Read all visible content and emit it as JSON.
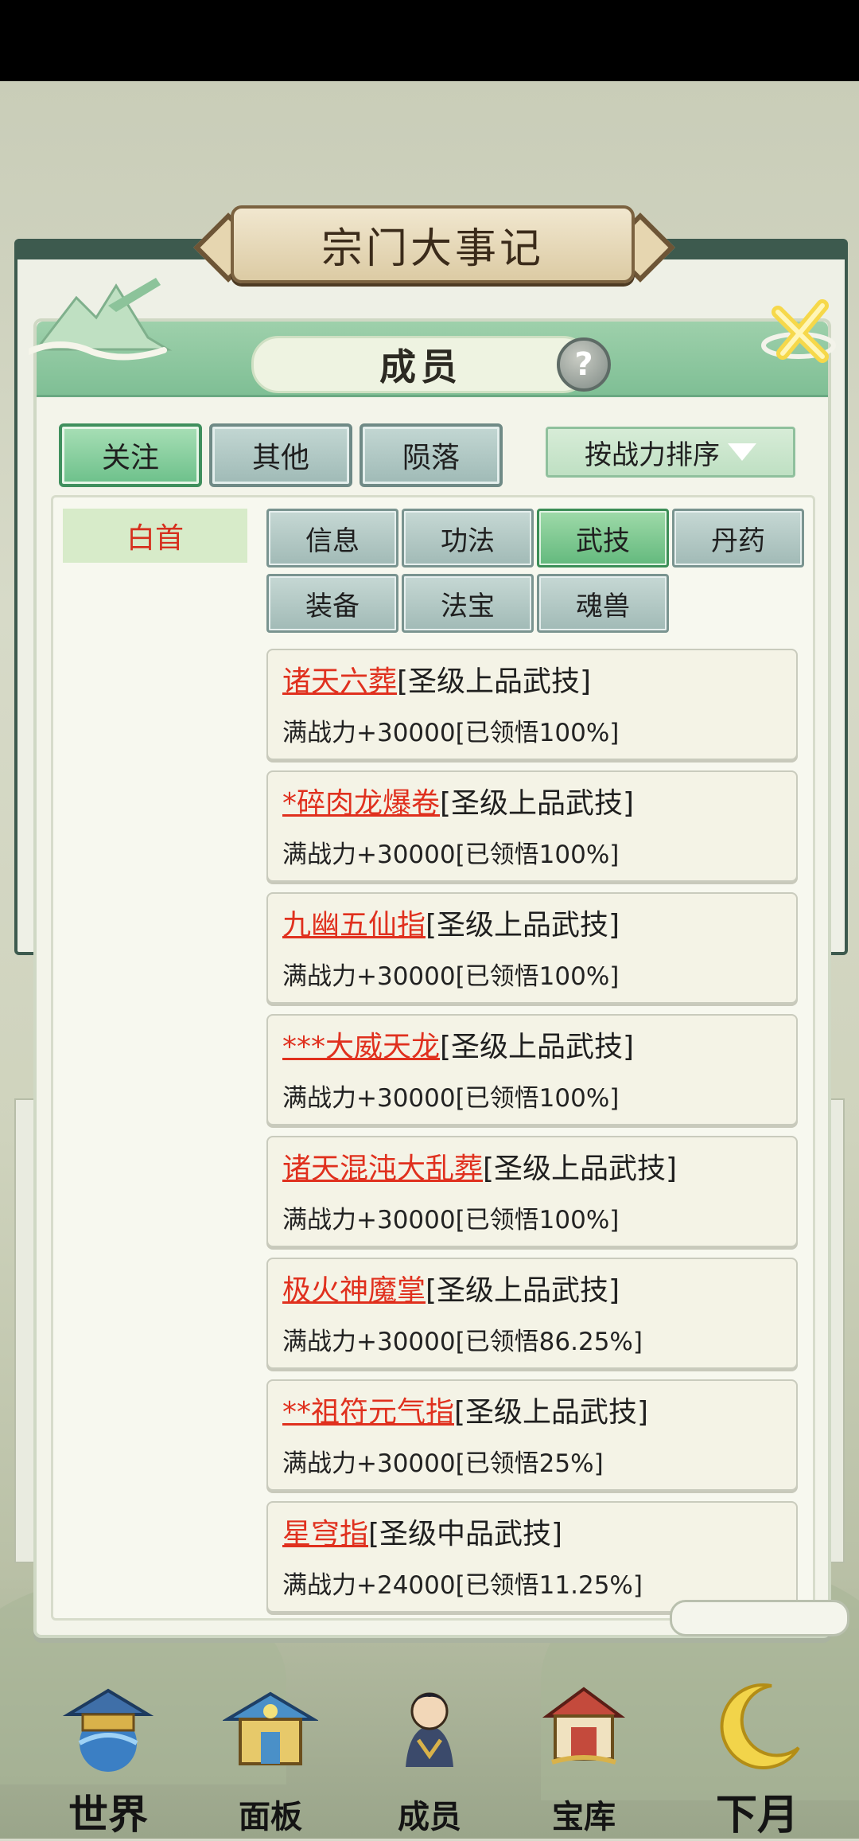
{
  "background": {
    "chronicle_title": "宗门大事记"
  },
  "dialog": {
    "title": "成员",
    "help_label": "?",
    "filters": [
      {
        "label": "关注",
        "active": true
      },
      {
        "label": "其他",
        "active": false
      },
      {
        "label": "陨落",
        "active": false
      }
    ],
    "sort": {
      "label": "按战力排序"
    },
    "member": {
      "name": "白首"
    },
    "category_tabs": [
      {
        "label": "信息",
        "active": false
      },
      {
        "label": "功法",
        "active": false
      },
      {
        "label": "武技",
        "active": true
      },
      {
        "label": "丹药",
        "active": false
      },
      {
        "label": "装备",
        "active": false
      },
      {
        "label": "法宝",
        "active": false
      },
      {
        "label": "魂兽",
        "active": false
      }
    ],
    "skills": [
      {
        "name": "诸天六葬",
        "grade": "[圣级上品武技]",
        "detail": "满战力+30000[已领悟100%]"
      },
      {
        "name": "*碎肉龙爆卷",
        "grade": "[圣级上品武技]",
        "detail": "满战力+30000[已领悟100%]"
      },
      {
        "name": "九幽五仙指",
        "grade": "[圣级上品武技]",
        "detail": "满战力+30000[已领悟100%]"
      },
      {
        "name": "***大威天龙",
        "grade": "[圣级上品武技]",
        "detail": "满战力+30000[已领悟100%]"
      },
      {
        "name": "诸天混沌大乱葬",
        "grade": "[圣级上品武技]",
        "detail": "满战力+30000[已领悟100%]"
      },
      {
        "name": "极火神魔掌",
        "grade": "[圣级上品武技]",
        "detail": "满战力+30000[已领悟86.25%]"
      },
      {
        "name": "**祖符元气指",
        "grade": "[圣级上品武技]",
        "detail": "满战力+30000[已领悟25%]"
      },
      {
        "name": "星穹指",
        "grade": "[圣级中品武技]",
        "detail": "满战力+24000[已领悟11.25%]"
      }
    ]
  },
  "bottom_nav": [
    {
      "label": "世界",
      "icon": "pavilion-globe-icon"
    },
    {
      "label": "面板",
      "icon": "temple-gate-icon"
    },
    {
      "label": "成员",
      "icon": "cultivator-icon"
    },
    {
      "label": "宝库",
      "icon": "treasure-hall-icon"
    },
    {
      "label": "下月",
      "icon": "crescent-moon-icon"
    }
  ],
  "colors": {
    "accent_green": "#6cc08a",
    "skill_name_red": "#e0301e",
    "member_name_red": "#d6301e"
  }
}
